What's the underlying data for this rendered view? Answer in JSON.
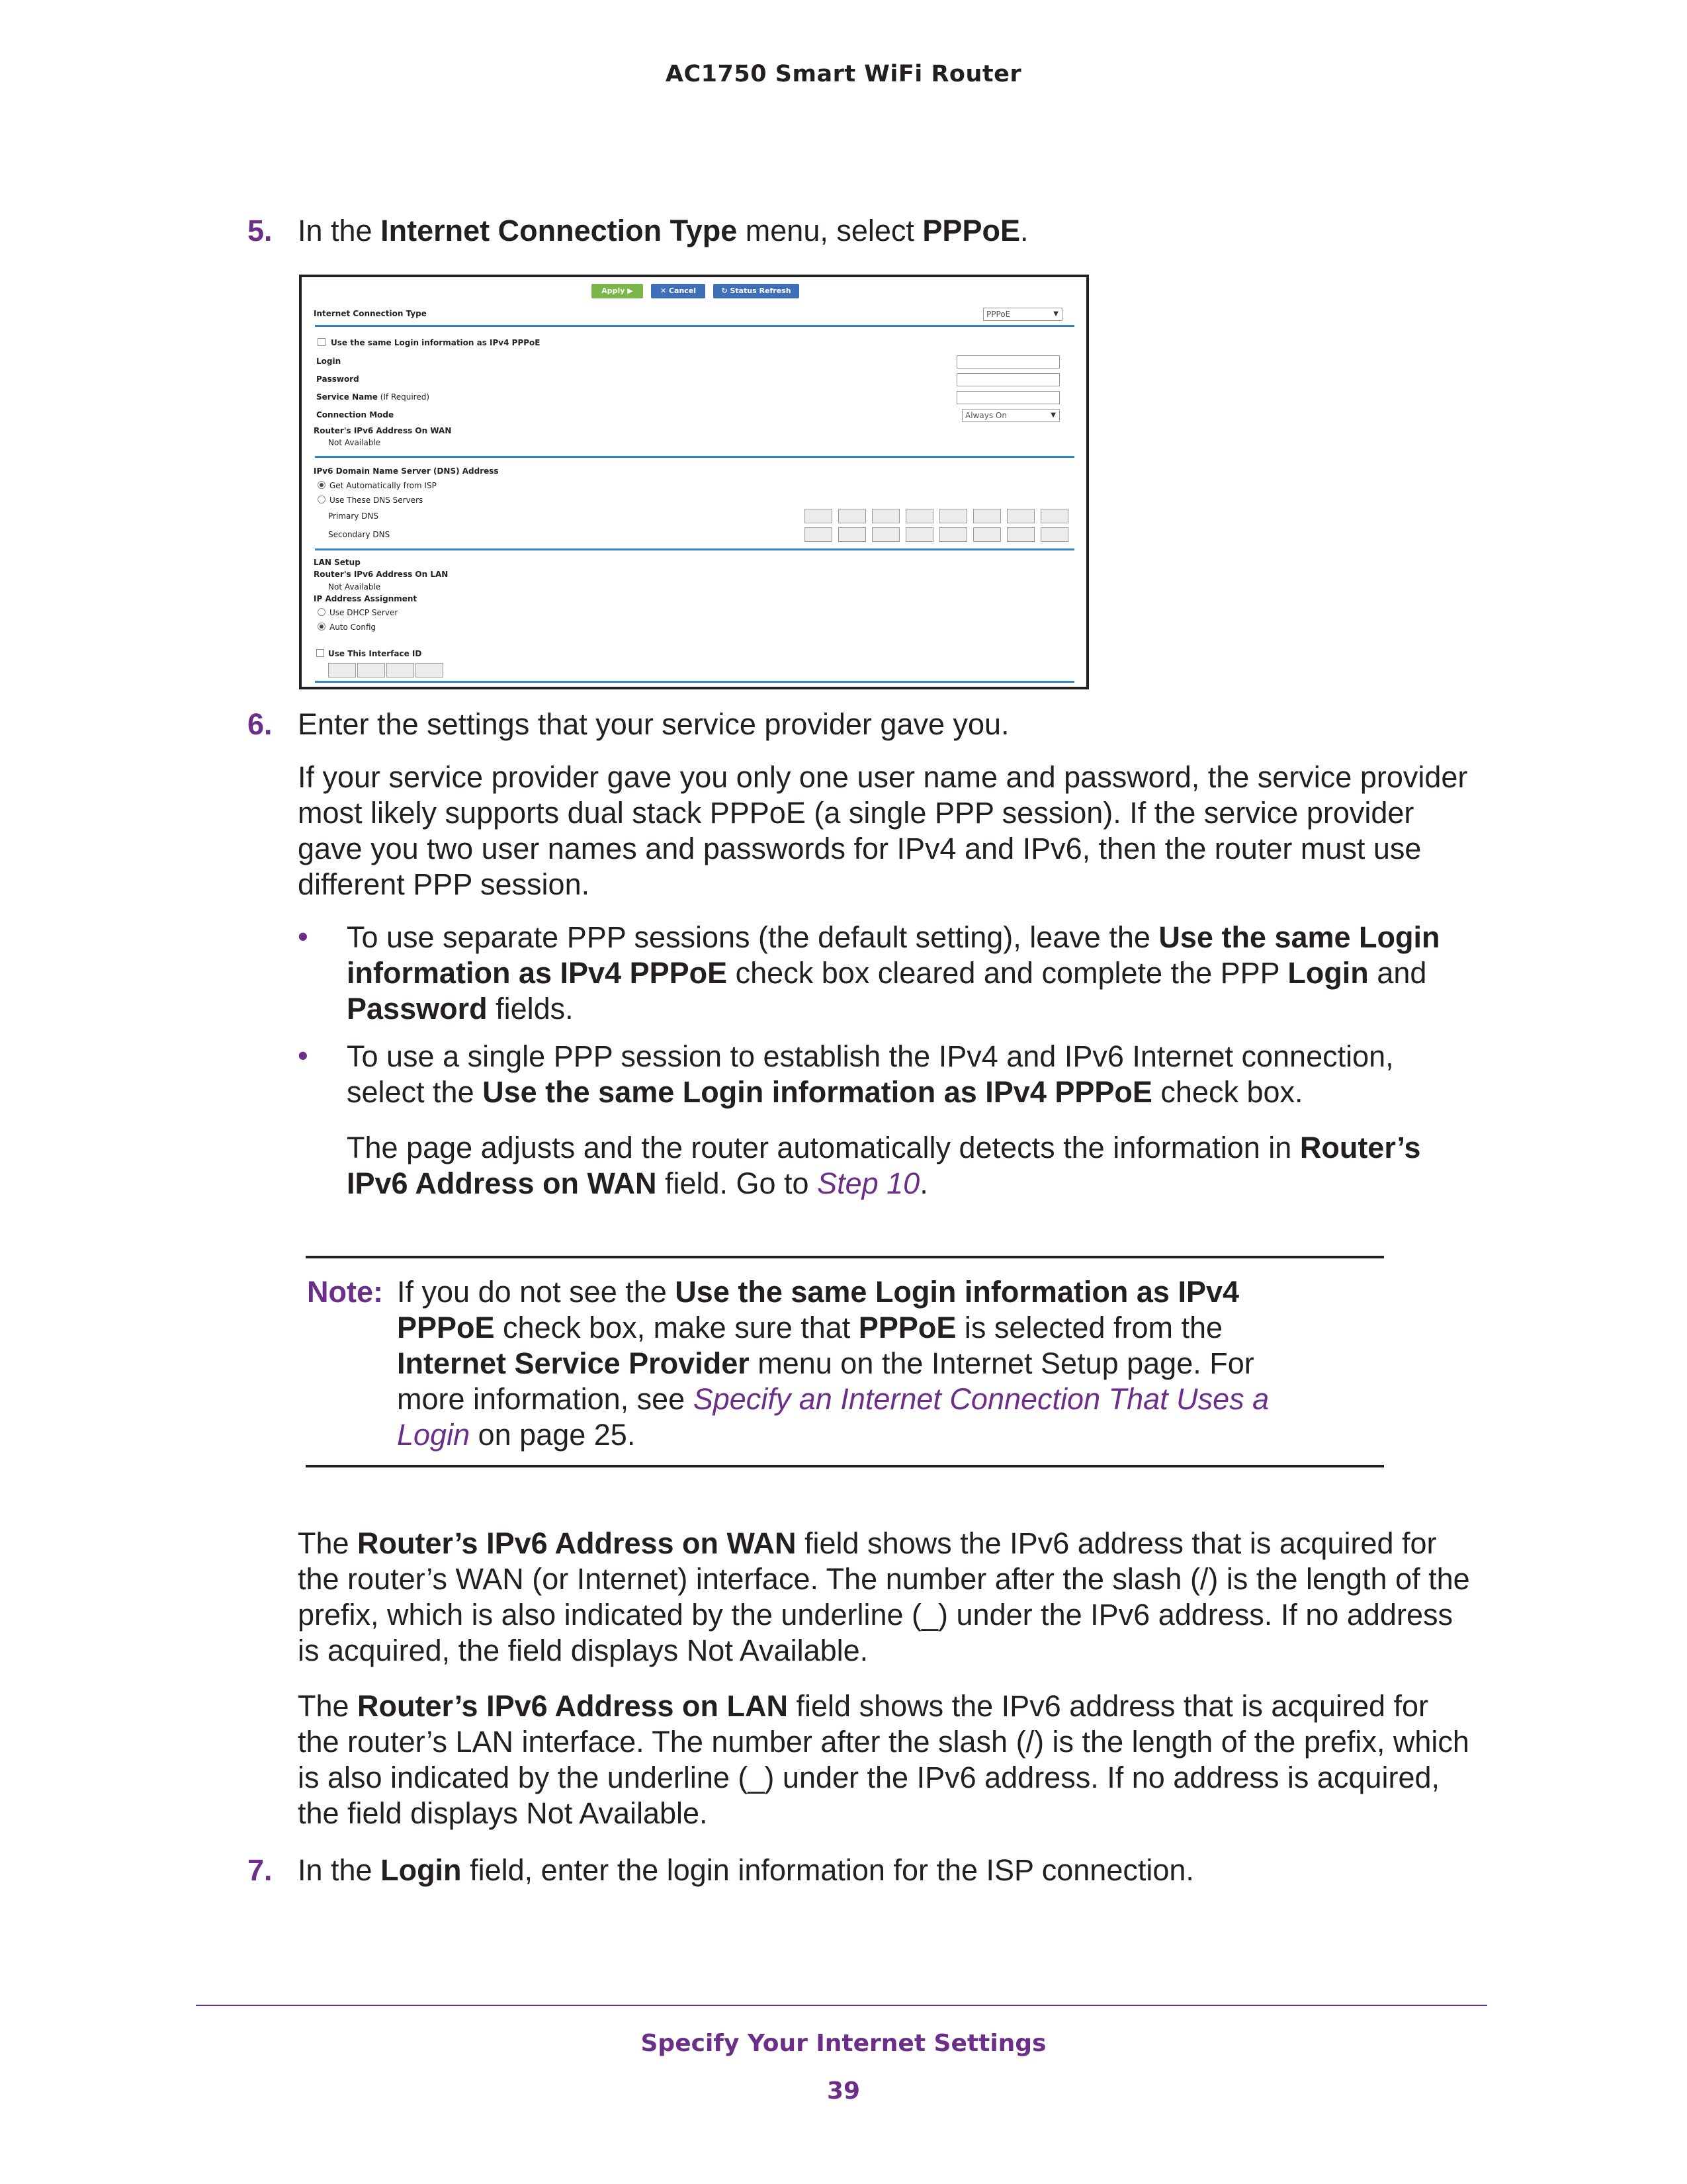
{
  "running_header": "AC1750 Smart WiFi Router",
  "step5": {
    "num": "5.",
    "t1": "In the ",
    "b1": "Internet Connection Type",
    "t2": " menu, select ",
    "b2": "PPPoE",
    "t3": "."
  },
  "screenshot": {
    "apply_label": "Apply ▶",
    "cancel_label": "✕ Cancel",
    "refresh_label": "↻ Status Refresh",
    "connection_type_label": "Internet Connection Type",
    "connection_type_value": "PPPoE",
    "same_login_label": "Use the same Login information as IPv4 PPPoE",
    "login_label": "Login",
    "password_label": "Password",
    "service_name_label": "Service Name",
    "service_name_hint": "(If Required)",
    "connection_mode_label": "Connection Mode",
    "connection_mode_value": "Always On",
    "wan_address_label": "Router's IPv6 Address On WAN",
    "wan_address_value": "Not Available",
    "dns_heading": "IPv6 Domain Name Server (DNS) Address",
    "dns_auto": "Get Automatically from ISP",
    "dns_manual": "Use These DNS Servers",
    "primary_dns": "Primary DNS",
    "secondary_dns": "Secondary DNS",
    "lan_setup": "LAN Setup",
    "lan_address_label": "Router's IPv6 Address On LAN",
    "lan_address_value": "Not Available",
    "ip_assignment": "IP Address Assignment",
    "use_dhcp": "Use DHCP Server",
    "auto_config": "Auto Config",
    "interface_id": "Use This Interface ID"
  },
  "step6": {
    "num": "6.",
    "text": "Enter the settings that your service provider gave you.",
    "para": [
      "If your service provider gave you only one user name and password, the service provider",
      "most likely supports dual stack PPPoE (a single PPP session). If the service provider",
      "gave you two user names and passwords for IPv4 and IPv6, then the router must use",
      "different PPP session."
    ],
    "bullet1": {
      "l1a": "To use separate PPP sessions (the default setting), leave the ",
      "l1b": "Use the same Login",
      "l2a": "information as IPv4 PPPoE",
      "l2b": " check box cleared and complete the PPP ",
      "l2c": "Login",
      "l2d": " and",
      "l3a": "Password",
      "l3b": " fields."
    },
    "bullet2": {
      "l1": "To use a single PPP session to establish the IPv4 and IPv6 Internet connection,",
      "l2a": "select the ",
      "l2b": "Use the same Login information as IPv4 PPPoE",
      "l2c": " check box."
    },
    "sub": {
      "l1a": "The page adjusts and the router automatically detects the information in ",
      "l1b": "Router’s",
      "l2a": "IPv6 Address on WAN",
      "l2b": " field. Go to ",
      "l2link": "Step 10",
      "l2c": "."
    }
  },
  "note": {
    "label": "Note:",
    "l1a": "If you do not see the ",
    "l1b": "Use the same Login information as IPv4",
    "l2a": "PPPoE",
    "l2b": " check box, make sure that ",
    "l2c": "PPPoE",
    "l2d": " is selected from the",
    "l3a": "Internet Service Provider",
    "l3b": " menu on the Internet Setup page. For",
    "l4a": "more information, see ",
    "l4link": "Specify an Internet Connection That Uses a",
    "l5link": "Login",
    "l5b": " on page 25."
  },
  "wan_para": {
    "l1a": "The ",
    "l1b": "Router’s IPv6 Address on WAN",
    "l1c": " field shows the IPv6 address that is acquired for",
    "l2": "the router’s WAN (or Internet) interface. The number after the slash (/) is the length of the",
    "l3": "prefix, which is also indicated by the underline (_) under the IPv6 address. If no address",
    "l4": "is acquired, the field displays Not Available."
  },
  "lan_para": {
    "l1a": "The ",
    "l1b": "Router’s IPv6 Address on LAN",
    "l1c": " field shows the IPv6 address that is acquired for",
    "l2": "the router’s LAN interface. The number after the slash (/) is the length of the prefix, which",
    "l3": "is also indicated by the underline (_) under the IPv6 address. If no address is acquired,",
    "l4": "the field displays Not Available."
  },
  "step7": {
    "num": "7.",
    "t1": "In the ",
    "b1": "Login",
    "t2": " field, enter the login information for the ISP connection."
  },
  "footer": {
    "section": "Specify Your Internet Settings",
    "page": "39"
  },
  "colors": {
    "accent": "#6b2f8a",
    "text": "#231f20",
    "blue_rule": "#2f86c9",
    "apply_green": "#7ab648",
    "button_blue": "#3f6fb8"
  }
}
